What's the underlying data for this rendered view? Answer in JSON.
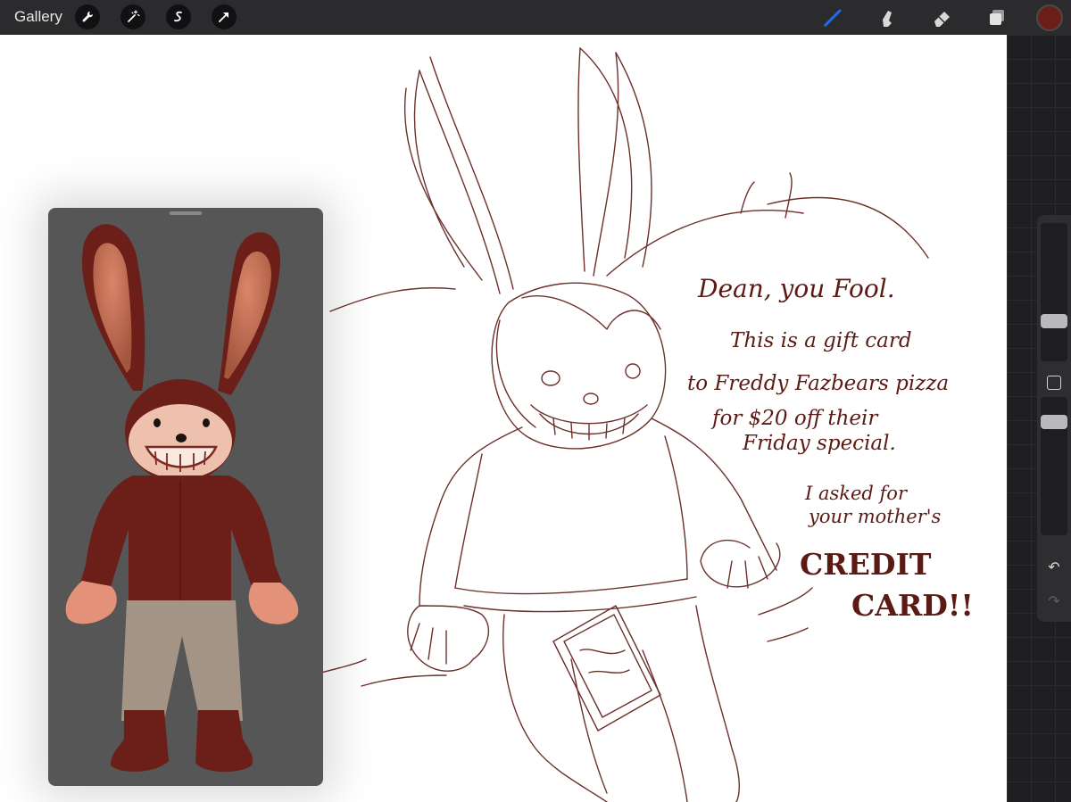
{
  "topbar": {
    "gallery_label": "Gallery",
    "left_tools": [
      "wrench-icon",
      "magic-wand-icon",
      "selection-icon",
      "transform-arrow-icon"
    ],
    "right_tools": [
      "brush-icon",
      "smudge-icon",
      "eraser-icon",
      "layers-icon"
    ],
    "active_tool": "brush",
    "active_color": "#6b1f19",
    "accent_color": "#1e6df0"
  },
  "sidebar": {
    "buttons": [
      "brush-size-slider",
      "modify-button",
      "opacity-slider",
      "undo-icon",
      "redo-icon"
    ]
  },
  "reference_window": {
    "background": "#565656",
    "content": "rabbit-character-render"
  },
  "canvas_note": {
    "line1": "Dean, you Fool.",
    "line2": "This is a gift card",
    "line3": "to Freddy Fazbears pizza",
    "line4": "for $20 off their",
    "line5": "Friday special.",
    "line6": "I asked for",
    "line7": "your mother's",
    "line8": "CREDIT",
    "line9": "CARD!!"
  },
  "sketch_color": "#5c1a14"
}
